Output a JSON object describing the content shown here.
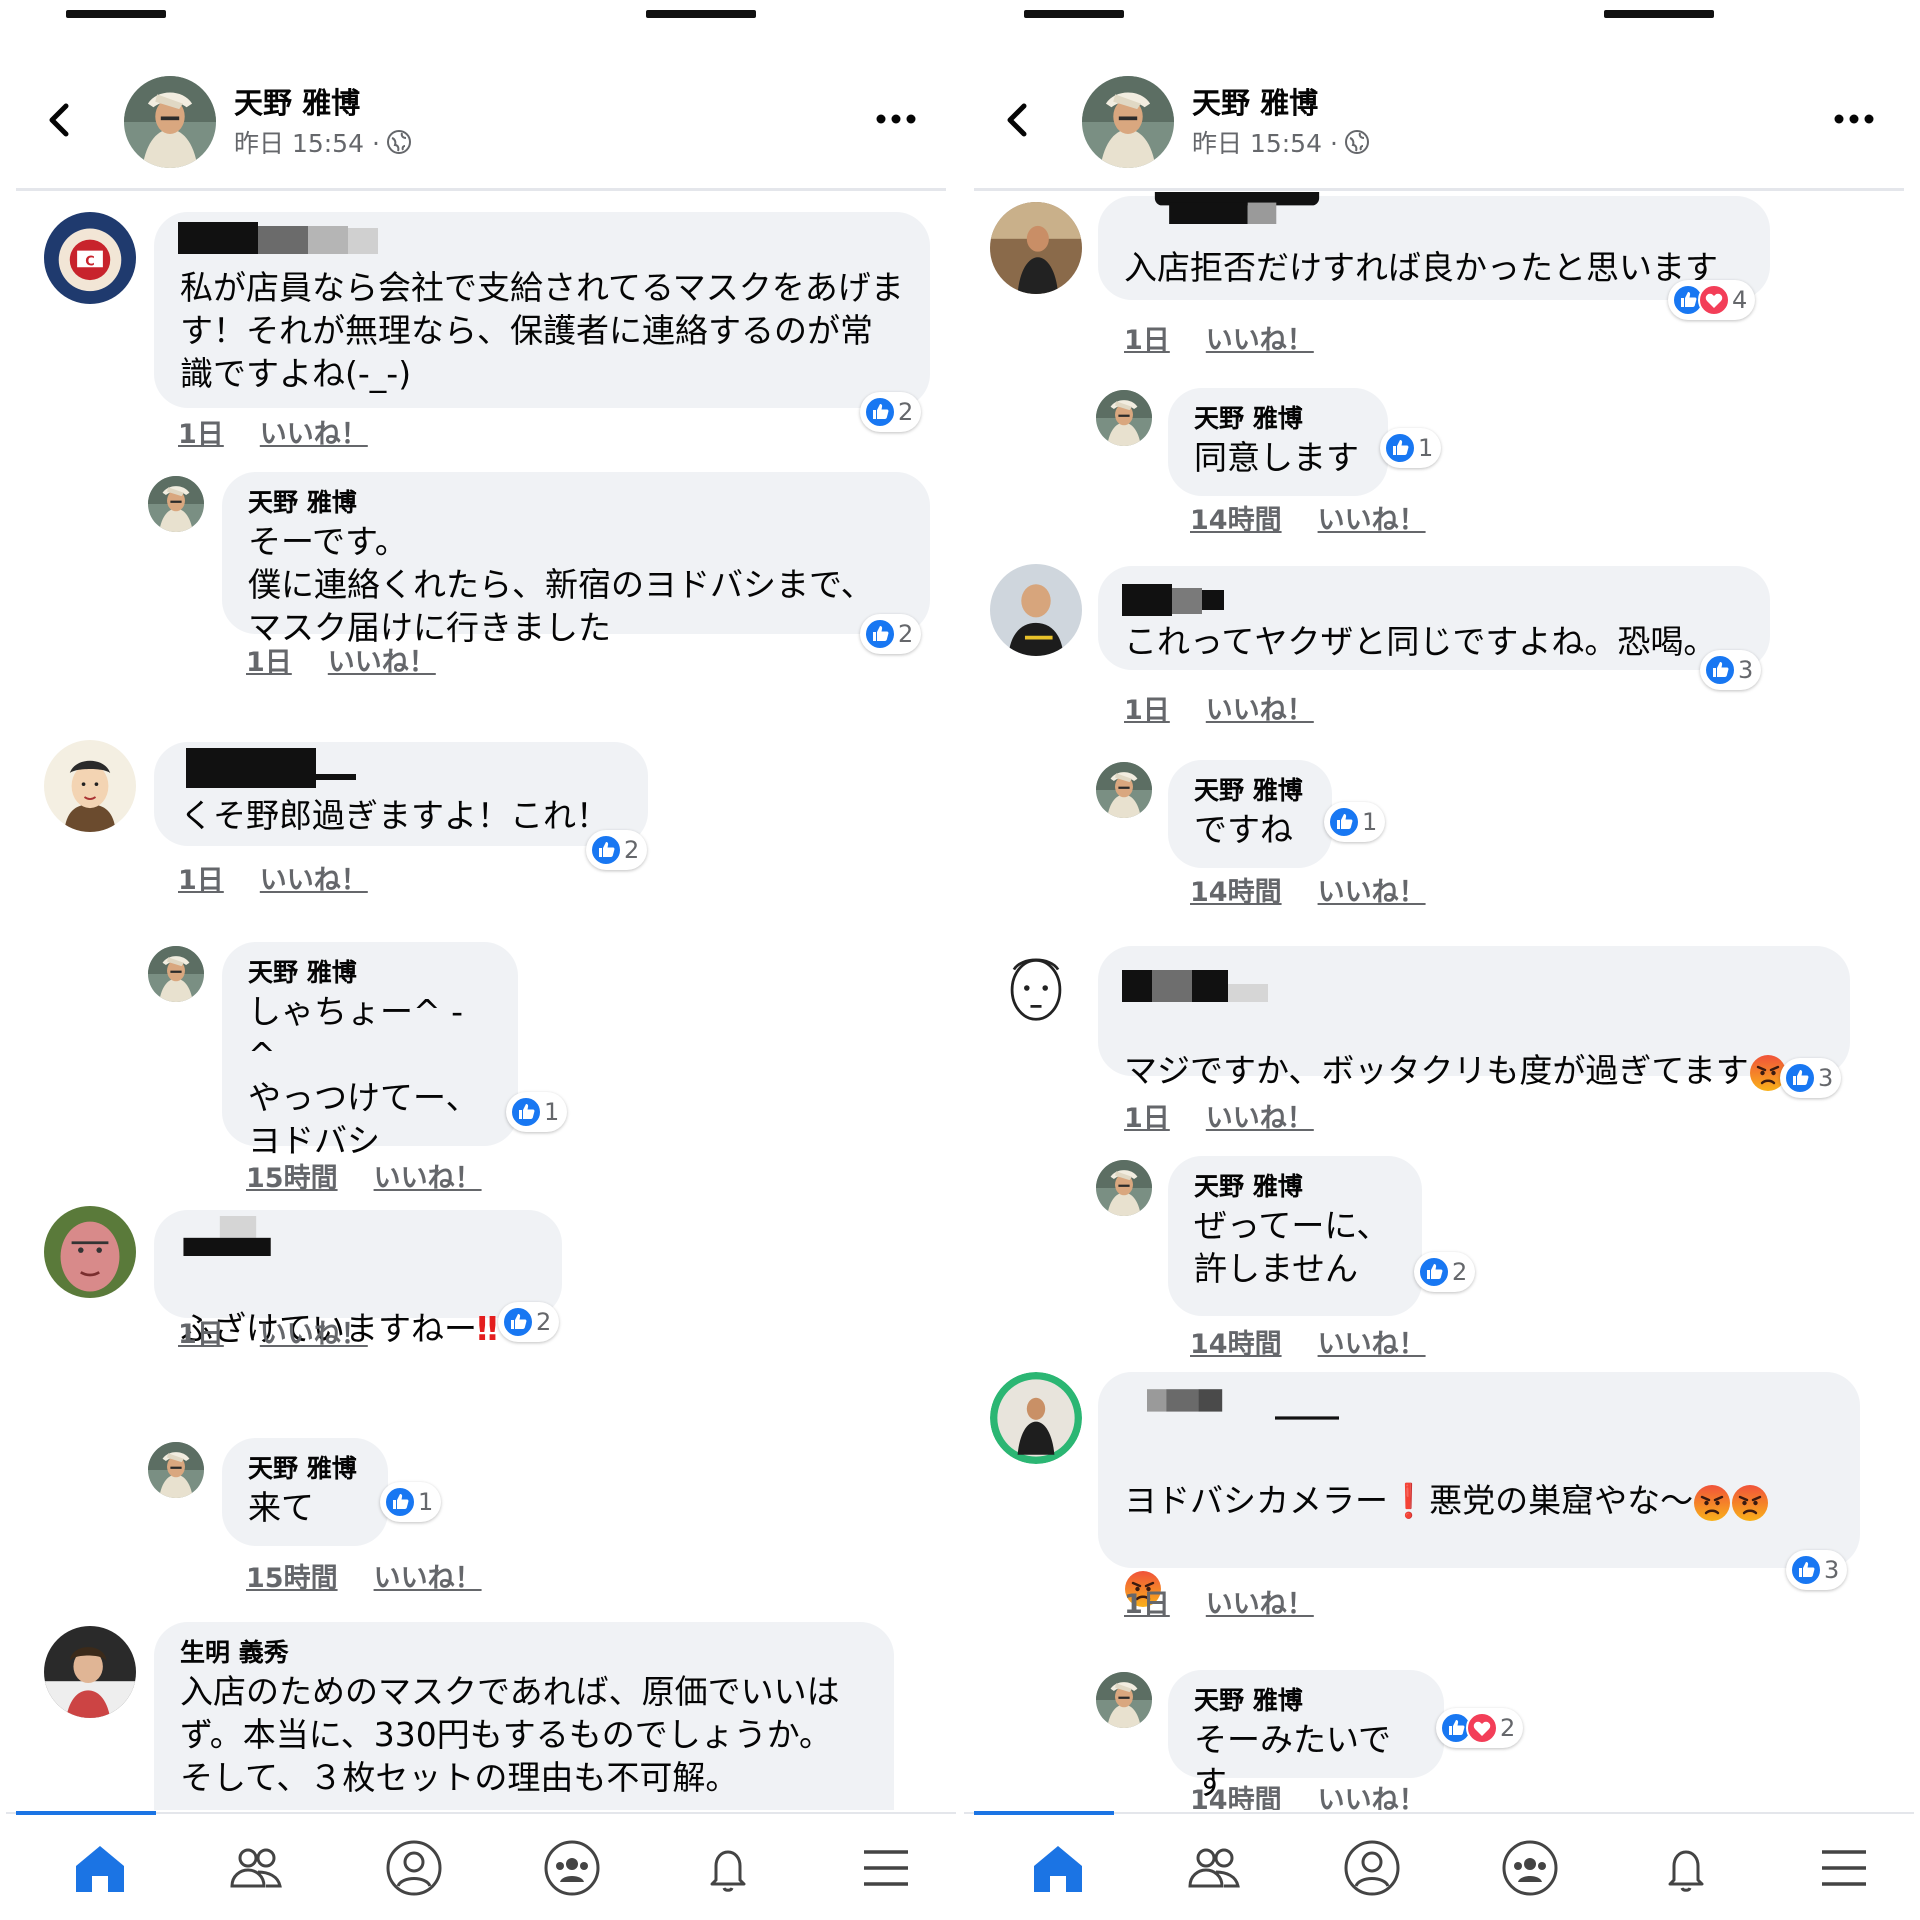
{
  "left": {
    "header": {
      "name": "天野 雅博",
      "time": "昨日 15:54 ·"
    },
    "comments": [
      {
        "author": "",
        "text": "私が店員なら会社で支給されてるマスクをあげます！それが無理なら、保護者に連絡するのが常識ですよね(-_-)",
        "time": "1日",
        "like": "いいね！",
        "count": "2"
      },
      {
        "author": "天野 雅博",
        "text": "そーです。\n僕に連絡くれたら、新宿のヨドバシまで、マスク届けに行きました",
        "time": "1日",
        "like": "いいね！",
        "count": "2"
      },
      {
        "author": "",
        "text": "くそ野郎過ぎますよ！これ！",
        "time": "1日",
        "like": "いいね！",
        "count": "2"
      },
      {
        "author": "天野 雅博",
        "text": "しゃちょー^ - ^\nやっつけてー、\nヨドバシ",
        "time": "15時間",
        "like": "いいね！",
        "count": "1"
      },
      {
        "author": "",
        "text": "ふざけていますねー",
        "exclaim": "‼",
        "time": "1日",
        "like": "いいね！",
        "count": "2"
      },
      {
        "author": "天野 雅博",
        "text": "来て",
        "time": "15時間",
        "like": "いいね！",
        "count": "1"
      },
      {
        "author": "生明 義秀",
        "text": "入店のためのマスクであれば、原価でいいはず。本当に、330円もするものでしょうか。\nそして、３枚セットの理由も不可解。"
      }
    ]
  },
  "right": {
    "header": {
      "name": "天野 雅博",
      "time": "昨日 15:54 ·"
    },
    "comments": [
      {
        "author": "",
        "text": "入店拒否だけすれば良かったと思います",
        "time": "1日",
        "like": "いいね！",
        "count": "4"
      },
      {
        "author": "天野 雅博",
        "text": "同意します",
        "time": "14時間",
        "like": "いいね！",
        "count": "1"
      },
      {
        "author": "",
        "text": "これってヤクザと同じですよね。恐喝。",
        "time": "1日",
        "like": "いいね！",
        "count": "3"
      },
      {
        "author": "天野 雅博",
        "text": "ですね",
        "time": "14時間",
        "like": "いいね！",
        "count": "1"
      },
      {
        "author": "",
        "text": "マジですか、ボッタクリも度が過ぎてます",
        "time": "1日",
        "like": "いいね！",
        "count": "3"
      },
      {
        "author": "天野 雅博",
        "text": "ぜってーに、\n許しません",
        "time": "14時間",
        "like": "いいね！",
        "count": "2"
      },
      {
        "author": "",
        "text_a": "ヨドバシカメラー",
        "exclaim": "❗",
        "text_b": "悪党の巣窟やな〜",
        "time": "1日",
        "like": "いいね！",
        "count": "3"
      },
      {
        "author": "天野 雅博",
        "text": "そーみたいです",
        "time": "14時間",
        "like": "いいね！",
        "count": "2"
      }
    ]
  },
  "colors": {
    "like_blue": "#1877f2",
    "heart_red": "#f33e58",
    "bubble": "#f0f2f5",
    "meta_gray": "#65676b",
    "tab_active": "#1b74e4"
  },
  "icons": [
    "back-arrow-icon",
    "globe-icon",
    "more-icon",
    "like-icon",
    "heart-icon",
    "angry-emoji-icon",
    "home-icon",
    "friends-icon",
    "profile-icon",
    "groups-icon",
    "bell-icon",
    "menu-icon"
  ]
}
